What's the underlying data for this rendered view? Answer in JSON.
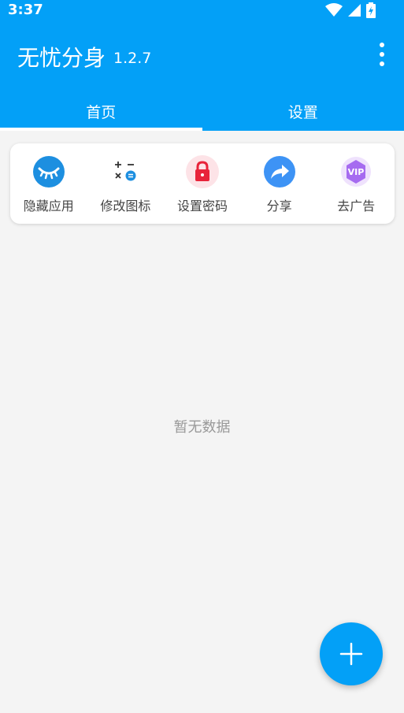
{
  "status": {
    "time": "3:37"
  },
  "app": {
    "title": "无忧分身",
    "version": "1.2.7"
  },
  "tabs": [
    {
      "label": "首页",
      "active": true
    },
    {
      "label": "设置",
      "active": false
    }
  ],
  "actions": [
    {
      "label": "隐藏应用",
      "icon": "eye-closed-icon"
    },
    {
      "label": "修改图标",
      "icon": "calculator-icon"
    },
    {
      "label": "设置密码",
      "icon": "lock-icon"
    },
    {
      "label": "分享",
      "icon": "share-icon"
    },
    {
      "label": "去广告",
      "icon": "vip-icon"
    }
  ],
  "empty_text": "暂无数据",
  "colors": {
    "primary": "#03a0f7",
    "lock": "#e8233a",
    "vip": "#a66bf0"
  }
}
